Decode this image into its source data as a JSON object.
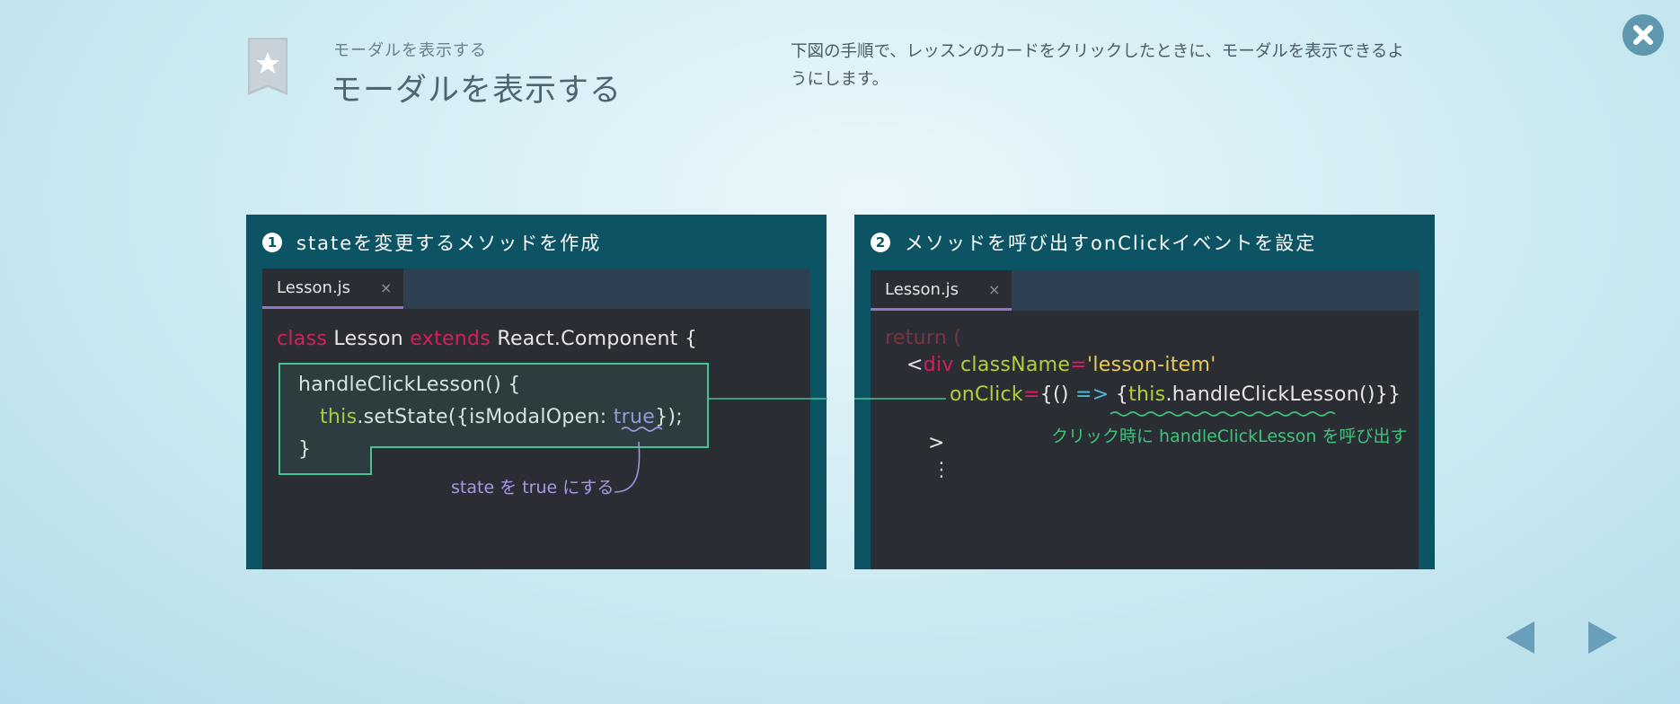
{
  "header": {
    "subtitle": "モーダルを表示する",
    "title": "モーダルを表示する",
    "description": "下図の手順で、レッスンのカードをクリックしたときに、モーダルを表示できるようにします。"
  },
  "icons": {
    "bookmark": "bookmark-star-icon",
    "close": "close-icon",
    "prev": "arrow-left-icon",
    "next": "arrow-right-icon"
  },
  "colors": {
    "panel_bg": "#0c5463",
    "editor_bg": "#2b2d35",
    "keyword": "#d81c5c",
    "function": "#b4cf3b",
    "string": "#e8cc55",
    "highlight": "#47c295",
    "note_purple": "#a898e8",
    "note_green": "#3fc27a"
  },
  "step1": {
    "number": "1",
    "title": "stateを変更するメソッドを作成",
    "tab_label": "Lesson.js",
    "tab_close": "×",
    "code": {
      "l1_kw1": "class",
      "l1_name": " Lesson ",
      "l1_kw2": "extends",
      "l1_rest": " React.Component {",
      "l2": "handleClickLesson() {",
      "l3_this": "this",
      "l3_mid": ".setState({isModalOpen: ",
      "l3_true": "true",
      "l3_end": "});",
      "l4": "}"
    },
    "note": "state を true にする"
  },
  "step2": {
    "number": "2",
    "title": "メソッドを呼び出すonClickイベントを設定",
    "tab_label": "Lesson.js",
    "tab_close": "×",
    "code": {
      "l1": "return (",
      "l2_lt": "<",
      "l2_tag": "div",
      "l2_attr": " className",
      "l2_eq": "=",
      "l2_str": "'lesson-item'",
      "l3_attr": "onClick",
      "l3_eq": "=",
      "l3_open": "{() ",
      "l3_arrow": "=>",
      "l3_brace": " {",
      "l3_this": "this",
      "l3_rest": ".handleClickLesson()}}",
      "l4": ">",
      "l5": "⋮"
    },
    "note": "クリック時に handleClickLesson を呼び出す"
  }
}
